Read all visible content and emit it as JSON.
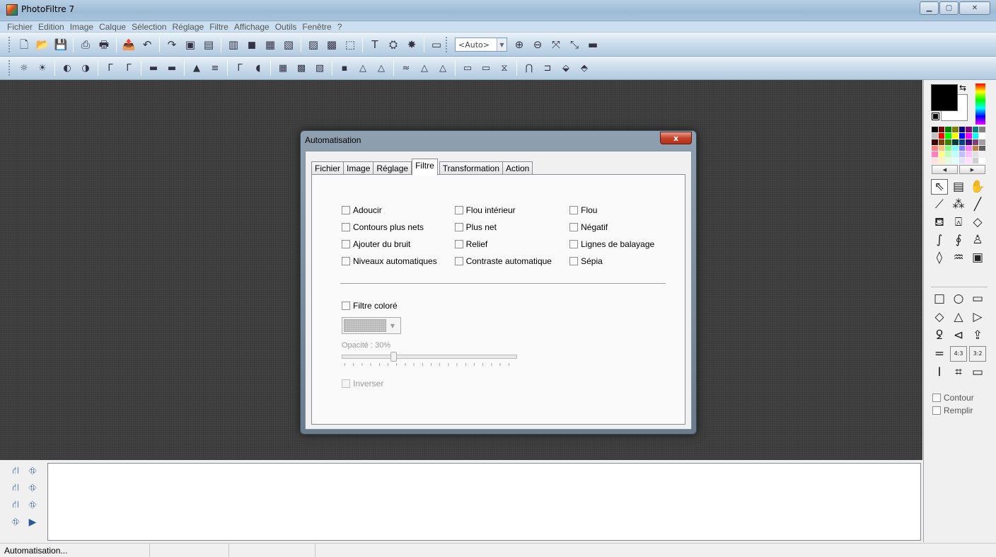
{
  "window": {
    "title": "PhotoFiltre 7"
  },
  "menu": [
    "Fichier",
    "Edition",
    "Image",
    "Calque",
    "Sélection",
    "Réglage",
    "Filtre",
    "Affichage",
    "Outils",
    "Fenêtre",
    "?"
  ],
  "toolbar1": {
    "icons_a": [
      "new-icon",
      "open-icon",
      "save-icon",
      "scan-icon",
      "print-icon",
      "export-icon",
      "undo-icon",
      "redo-icon",
      "paste-icon",
      "paste-as-image-icon",
      "paste-layer-icon",
      "frame-icon",
      "pattern-icon",
      "transparency-icon",
      "crop-icon",
      "fit-icon",
      "selection-icon",
      "text-icon",
      "stamp-icon",
      "effects-icon",
      "window-icon"
    ],
    "glyphs_a": [
      "🗋",
      "📂",
      "💾",
      "⎙",
      "🖶",
      "📤",
      "↶",
      "↷",
      "▣",
      "▤",
      "▥",
      "◼",
      "▦",
      "▧",
      "▨",
      "▩",
      "⬚",
      "T",
      "⛭",
      "✸",
      "▭"
    ],
    "zoom_value": "<Auto>",
    "icons_b": [
      "zoom-in-icon",
      "zoom-out-icon",
      "actual-size-icon",
      "fit-window-icon",
      "fullscreen-icon"
    ],
    "glyphs_b": [
      "⊕",
      "⊖",
      "⤧",
      "⤡",
      "▬"
    ]
  },
  "toolbar2": {
    "icons": [
      "brightness-minus-icon",
      "brightness-plus-icon",
      "contrast-minus-icon",
      "contrast-plus-icon",
      "gamma-minus-icon",
      "gamma-plus-icon",
      "saturation-minus-icon",
      "saturation-plus-icon",
      "levels-icon",
      "curves-icon",
      "auto-levels-icon",
      "auto-contrast-icon",
      "grid-icon",
      "grid-bold-icon",
      "grid-x-icon",
      "sharpen-icon",
      "drop-icon",
      "drop-outline-icon",
      "relief-icon",
      "triangle-icon",
      "triangle-outline-icon",
      "flip-h-icon",
      "flip-v-icon",
      "transform-icon",
      "text-effect-icon",
      "mask-icon",
      "gradient-icon",
      "plugin-icon"
    ],
    "glyphs": [
      "☼",
      "☀",
      "◐",
      "◑",
      "Γ",
      "Γ",
      "▬",
      "▬",
      "▲",
      "≡",
      "Γ",
      "◖",
      "▦",
      "▩",
      "▧",
      "▪",
      "△",
      "△",
      "≈",
      "△",
      "△",
      "▭",
      "▭",
      "⧖",
      "⋂",
      "⊐",
      "⬙",
      "⬘"
    ]
  },
  "dialog": {
    "title": "Automatisation",
    "close": "x",
    "tabs": [
      "Fichier",
      "Image",
      "Réglage",
      "Filtre",
      "Transformation",
      "Action"
    ],
    "active_tab": "Filtre",
    "options": [
      [
        "Adoucir",
        "Flou intérieur",
        "Flou"
      ],
      [
        "Contours plus nets",
        "Plus net",
        "Négatif"
      ],
      [
        "Ajouter du bruit",
        "Relief",
        "Lignes de balayage"
      ],
      [
        "Niveaux automatiques",
        "Contraste automatique",
        "Sépia"
      ]
    ],
    "filtre_colore": "Filtre coloré",
    "opacity_label": "Opacité : 30%",
    "opacity_value": 0.3,
    "inverser": "Inverser"
  },
  "right_panel": {
    "swatches": [
      "#000000",
      "#800000",
      "#008000",
      "#808000",
      "#000080",
      "#800080",
      "#008080",
      "#808080",
      "#c0c0c0",
      "#ff0000",
      "#00ff00",
      "#ffff00",
      "#0000ff",
      "#ff00ff",
      "#00ffff",
      "#ffffff",
      "#400000",
      "#804000",
      "#408000",
      "#004040",
      "#004080",
      "#400080",
      "#804080",
      "#a0a0a0",
      "#ff8080",
      "#ffc080",
      "#80ff80",
      "#80ffff",
      "#8080ff",
      "#ff80ff",
      "#c08040",
      "#606060",
      "#ff80c0",
      "#ffff80",
      "#c0ffc0",
      "#c0ffff",
      "#c0c0ff",
      "#ffc0ff",
      "#e0e0e0",
      "#f0f0f0",
      "#ffe0e0",
      "#fff0c0",
      "#e0ffe0",
      "#e0ffff",
      "#e0e0ff",
      "#ffe0ff",
      "#d0d0d0",
      "#ffffff"
    ],
    "tools": [
      "pointer-icon",
      "layer-move-icon",
      "hand-icon",
      "eyedropper-icon",
      "magic-wand-icon",
      "line-icon",
      "fill-icon",
      "spray-icon",
      "eraser-icon",
      "brush-icon",
      "advanced-brush-icon",
      "clone-stamp-icon",
      "blur-drop-icon",
      "smudge-icon",
      "pattern-fill-icon"
    ],
    "tool_glyphs": [
      "⇖",
      "▤",
      "✋",
      "⟋",
      "⁂",
      "╱",
      "⛾",
      "⍓",
      "◇",
      "∫",
      "∮",
      "♙",
      "◊",
      "♒",
      "▣"
    ],
    "shapes": [
      "rectangle-icon",
      "ellipse-icon",
      "rounded-rect-icon",
      "diamond-icon",
      "triangle-icon",
      "arrow-icon",
      "lasso-icon",
      "polygon-lasso-icon",
      "open-selection-icon",
      "ratio-free-icon",
      "ratio-43-icon",
      "ratio-32-icon",
      "text-select-icon",
      "grid-select-icon",
      "card-icon"
    ],
    "shape_glyphs": [
      "□",
      "○",
      "▭",
      "◇",
      "△",
      "▷",
      "ꝿ",
      "⊲",
      "⇪",
      "=",
      "4:3",
      "3:2",
      "I",
      "⌗",
      "▭"
    ],
    "contour": "Contour",
    "remplir": "Remplir"
  },
  "bottom": {
    "icons": [
      "layer-tree-icon",
      "layer-image-icon",
      "layer-add-icon",
      "layer-copy-icon",
      "layer-frame-icon",
      "layer-select-icon",
      "layer-thumb-icon",
      "play-icon"
    ],
    "glyphs": [
      "⛙",
      "⛗",
      "⛙",
      "⛗",
      "⛙",
      "⛗",
      "⛗",
      "▶"
    ]
  },
  "status": {
    "text": "Automatisation..."
  }
}
